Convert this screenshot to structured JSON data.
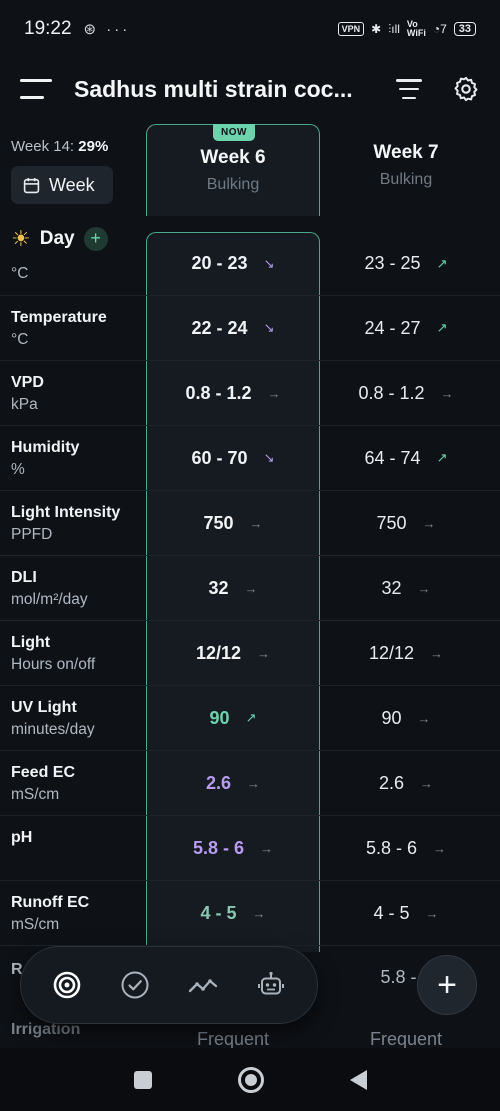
{
  "status": {
    "time": "19:22",
    "left_icons": "⊛ ···",
    "vpn": "VPN",
    "bluetooth": "✱",
    "signal": "⫶ıll",
    "vowifi_top": "Vo",
    "vowifi_bottom": "WiFi",
    "wifi": "◔7",
    "battery": "33"
  },
  "header": {
    "title": "Sadhus multi strain coc..."
  },
  "overview": {
    "week_prefix": "Week 14:",
    "week_percent": "29%",
    "chip_label": "Week"
  },
  "columns": [
    {
      "name": "Week 6",
      "phase": "Bulking",
      "badge": "NOW"
    },
    {
      "name": "Week 7",
      "phase": "Bulking"
    }
  ],
  "section": {
    "label": "Day",
    "icon": "sun-icon"
  },
  "rows": [
    {
      "label": "",
      "unit": "°C",
      "c1": "20 - 23",
      "c1_arrow": "↘",
      "c2": "23 - 25",
      "c2_arrow": "↗"
    },
    {
      "label": "Temperature",
      "unit": "°C",
      "c1": "22 - 24",
      "c1_arrow": "↘",
      "c2": "24 - 27",
      "c2_arrow": "↗"
    },
    {
      "label": "VPD",
      "unit": "kPa",
      "c1": "0.8 - 1.2",
      "c1_arrow": "→",
      "c2": "0.8 - 1.2",
      "c2_arrow": "→"
    },
    {
      "label": "Humidity",
      "unit": "%",
      "c1": "60 - 70",
      "c1_arrow": "↘",
      "c2": "64 - 74",
      "c2_arrow": "↗"
    },
    {
      "label": "Light Intensity",
      "unit": "PPFD",
      "c1": "750",
      "c1_arrow": "→",
      "c2": "750",
      "c2_arrow": "→"
    },
    {
      "label": "DLI",
      "unit": "mol/m²/day",
      "c1": "32",
      "c1_arrow": "→",
      "c2": "32",
      "c2_arrow": "→"
    },
    {
      "label": "Light",
      "unit": "Hours on/off",
      "c1": "12/12",
      "c1_arrow": "→",
      "c2": "12/12",
      "c2_arrow": "→"
    },
    {
      "label": "UV Light",
      "unit": "minutes/day",
      "c1": "90",
      "c1_arrow": "↗",
      "c2": "90",
      "c2_arrow": "→"
    },
    {
      "label": "Feed EC",
      "unit": "mS/cm",
      "c1": "2.6",
      "c1_arrow": "→",
      "c2": "2.6",
      "c2_arrow": "→"
    },
    {
      "label": "pH",
      "unit": "",
      "c1": "5.8 - 6",
      "c1_arrow": "→",
      "c2": "5.8 - 6",
      "c2_arrow": "→"
    },
    {
      "label": "Runoff EC",
      "unit": "mS/cm",
      "c1": "4 - 5",
      "c1_arrow": "→",
      "c2": "4 - 5",
      "c2_arrow": "→"
    }
  ],
  "partial": {
    "runoff_ph_label": "R",
    "runoff_ph_c2": "5.8 - 6",
    "irrigation_label": "Irrigation",
    "irrigation_c1": "Frequent",
    "irrigation_c2": "Frequent"
  },
  "colors": {
    "accent": "#6dd3ad",
    "purple": "#b79cf0",
    "background": "#0e1116"
  }
}
